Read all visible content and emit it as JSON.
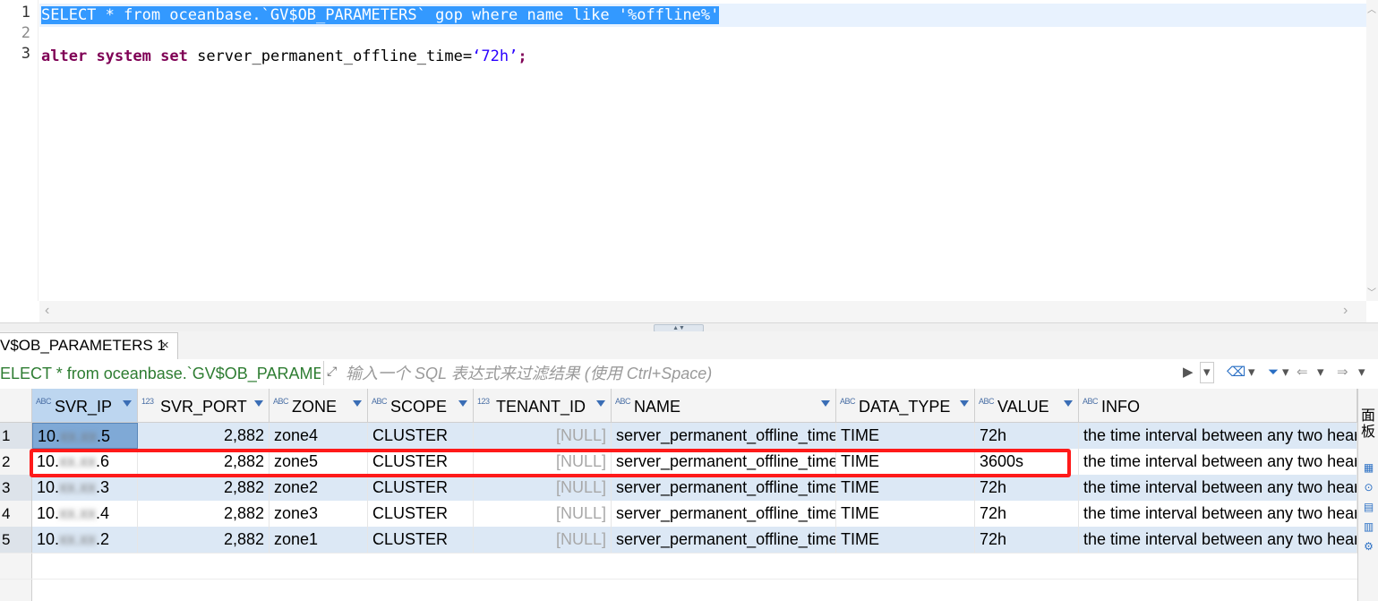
{
  "editor": {
    "line_numbers": [
      "1",
      "2",
      "3"
    ],
    "line1": "SELECT * from oceanbase.`GV$OB_PARAMETERS` gop where name like '%offline%'",
    "line3": {
      "kw1": "alter",
      "kw2": "system",
      "kw3": "set",
      "rest": "server_permanent_offline_time=",
      "value": "‘72h’",
      "semicolon": ";"
    }
  },
  "results": {
    "tab_label": "V$OB_PARAMETERS 1",
    "tab_close": "×",
    "filter_query": "ELECT * from oceanbase.`GV$OB_PARAMETERS` gop where name like '%offline%'",
    "filter_placeholder": "输入一个 SQL 表达式来过滤结果 (使用 Ctrl+Space)",
    "columns": [
      {
        "type": "ABC",
        "name": "SVR_IP"
      },
      {
        "type": "123",
        "name": "SVR_PORT"
      },
      {
        "type": "ABC",
        "name": "ZONE"
      },
      {
        "type": "ABC",
        "name": "SCOPE"
      },
      {
        "type": "123",
        "name": "TENANT_ID"
      },
      {
        "type": "ABC",
        "name": "NAME"
      },
      {
        "type": "ABC",
        "name": "DATA_TYPE"
      },
      {
        "type": "ABC",
        "name": "VALUE"
      },
      {
        "type": "ABC",
        "name": "INFO"
      }
    ],
    "rows": [
      {
        "n": "1",
        "ip_a": "10.",
        "ip_b": "xx.xx",
        "ip_c": ".5",
        "port": "2,882",
        "zone": "zone4",
        "scope": "CLUSTER",
        "tenant": "[NULL]",
        "name": "server_permanent_offline_time",
        "dtype": "TIME",
        "value": "72h",
        "info": "the time interval between any two heartbeats"
      },
      {
        "n": "2",
        "ip_a": "10.",
        "ip_b": "xx.xx",
        "ip_c": ".6",
        "port": "2,882",
        "zone": "zone5",
        "scope": "CLUSTER",
        "tenant": "[NULL]",
        "name": "server_permanent_offline_time",
        "dtype": "TIME",
        "value": "3600s",
        "info": "the time interval between any two heartbeats"
      },
      {
        "n": "3",
        "ip_a": "10.",
        "ip_b": "xx.xx",
        "ip_c": ".3",
        "port": "2,882",
        "zone": "zone2",
        "scope": "CLUSTER",
        "tenant": "[NULL]",
        "name": "server_permanent_offline_time",
        "dtype": "TIME",
        "value": "72h",
        "info": "the time interval between any two heartbeats"
      },
      {
        "n": "4",
        "ip_a": "10.",
        "ip_b": "xx.xx",
        "ip_c": ".4",
        "port": "2,882",
        "zone": "zone3",
        "scope": "CLUSTER",
        "tenant": "[NULL]",
        "name": "server_permanent_offline_time",
        "dtype": "TIME",
        "value": "72h",
        "info": "the time interval between any two heartbeats"
      },
      {
        "n": "5",
        "ip_a": "10.",
        "ip_b": "xx.xx",
        "ip_c": ".2",
        "port": "2,882",
        "zone": "zone1",
        "scope": "CLUSTER",
        "tenant": "[NULL]",
        "name": "server_permanent_offline_time",
        "dtype": "TIME",
        "value": "72h",
        "info": "the time interval between any two heartbeats"
      }
    ],
    "side_panel_label": "面板"
  },
  "colors": {
    "selection": "#3399ff",
    "keyword": "#7f0055",
    "string": "#2a00ff",
    "highlight_box": "#ff1a1a",
    "row_shade": "#dce8f5"
  }
}
